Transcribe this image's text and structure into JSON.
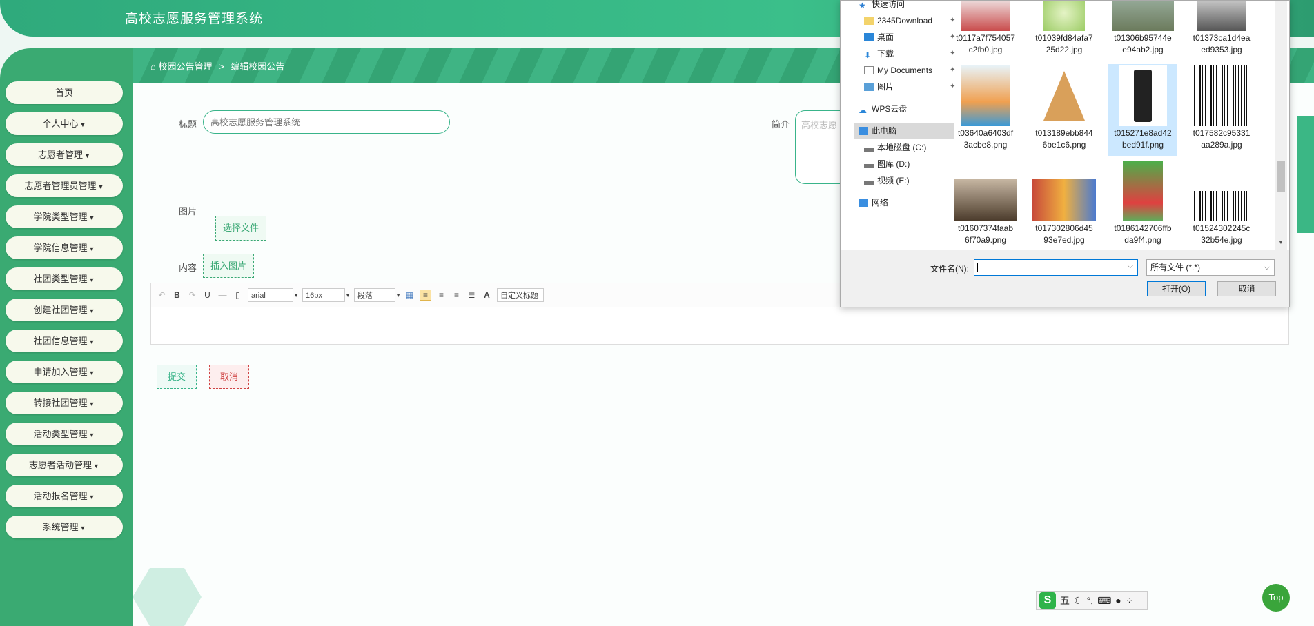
{
  "app": {
    "title": "高校志愿服务管理系统"
  },
  "breadcrumb": {
    "home_label": "校园公告管理",
    "separator": ">",
    "current": "编辑校园公告"
  },
  "sidebar": {
    "items": [
      {
        "label": "首页",
        "has_caret": false
      },
      {
        "label": "个人中心",
        "has_caret": true
      },
      {
        "label": "志愿者管理",
        "has_caret": true
      },
      {
        "label": "志愿者管理员管理",
        "has_caret": true
      },
      {
        "label": "学院类型管理",
        "has_caret": true
      },
      {
        "label": "学院信息管理",
        "has_caret": true
      },
      {
        "label": "社团类型管理",
        "has_caret": true
      },
      {
        "label": "创建社团管理",
        "has_caret": true
      },
      {
        "label": "社团信息管理",
        "has_caret": true
      },
      {
        "label": "申请加入管理",
        "has_caret": true
      },
      {
        "label": "转接社团管理",
        "has_caret": true
      },
      {
        "label": "活动类型管理",
        "has_caret": true
      },
      {
        "label": "志愿者活动管理",
        "has_caret": true
      },
      {
        "label": "活动报名管理",
        "has_caret": true
      },
      {
        "label": "系统管理",
        "has_caret": true
      }
    ]
  },
  "form": {
    "title_label": "标题",
    "title_placeholder": "高校志愿服务管理系统",
    "summary_label": "简介",
    "summary_placeholder": "高校志愿",
    "image_label": "图片",
    "choose_file": "选择文件",
    "content_label": "内容",
    "insert_image": "插入图片",
    "submit": "提交",
    "cancel": "取消"
  },
  "editor": {
    "font": "arial",
    "size": "16px",
    "paragraph": "段落",
    "custom_title": "自定义标题",
    "bold": "B",
    "underline": "U",
    "font_color": "A"
  },
  "dialog": {
    "tree": [
      {
        "label": "快速访问",
        "icon": "star-icon",
        "pinned": false
      },
      {
        "label": "2345Download",
        "icon": "folder-icon",
        "pinned": true
      },
      {
        "label": "桌面",
        "icon": "desktop-icon",
        "pinned": true
      },
      {
        "label": "下载",
        "icon": "download-icon",
        "pinned": true
      },
      {
        "label": "My Documents",
        "icon": "document-icon",
        "pinned": true
      },
      {
        "label": "图片",
        "icon": "pictures-icon",
        "pinned": true
      },
      {
        "label": "WPS云盘",
        "icon": "cloud-icon",
        "pinned": false
      },
      {
        "label": "此电脑",
        "icon": "computer-icon",
        "pinned": false
      },
      {
        "label": "本地磁盘 (C:)",
        "icon": "drive-icon",
        "pinned": false
      },
      {
        "label": "图库 (D:)",
        "icon": "drive-icon",
        "pinned": false
      },
      {
        "label": "视频 (E:)",
        "icon": "drive-icon",
        "pinned": false
      },
      {
        "label": "网络",
        "icon": "network-icon",
        "pinned": false
      }
    ],
    "files": [
      {
        "line1": "t0117a7f754057",
        "line2": "c2fb0.jpg"
      },
      {
        "line1": "t01039fd84afa7",
        "line2": "25d22.jpg"
      },
      {
        "line1": "t01306b95744e",
        "line2": "e94ab2.jpg"
      },
      {
        "line1": "t01373ca1d4ea",
        "line2": "ed9353.jpg"
      },
      {
        "line1": "t03640a6403df",
        "line2": "3acbe8.png"
      },
      {
        "line1": "t013189ebb844",
        "line2": "6be1c6.png"
      },
      {
        "line1": "t015271e8ad42",
        "line2": "bed91f.png"
      },
      {
        "line1": "t017582c95331",
        "line2": "aa289a.jpg"
      },
      {
        "line1": "t01607374faab",
        "line2": "6f70a9.png"
      },
      {
        "line1": "t017302806d45",
        "line2": "93e7ed.jpg"
      },
      {
        "line1": "t0186142706ffb",
        "line2": "da9f4.png"
      },
      {
        "line1": "t01524302245c",
        "line2": "32b54e.jpg"
      }
    ],
    "selected_file_index": 6,
    "filename_label": "文件名(N):",
    "filename_value": "",
    "filetype": "所有文件 (*.*)",
    "open": "打开(O)",
    "cancel": "取消"
  },
  "ime": {
    "mode": "五"
  },
  "top_button": "Top"
}
